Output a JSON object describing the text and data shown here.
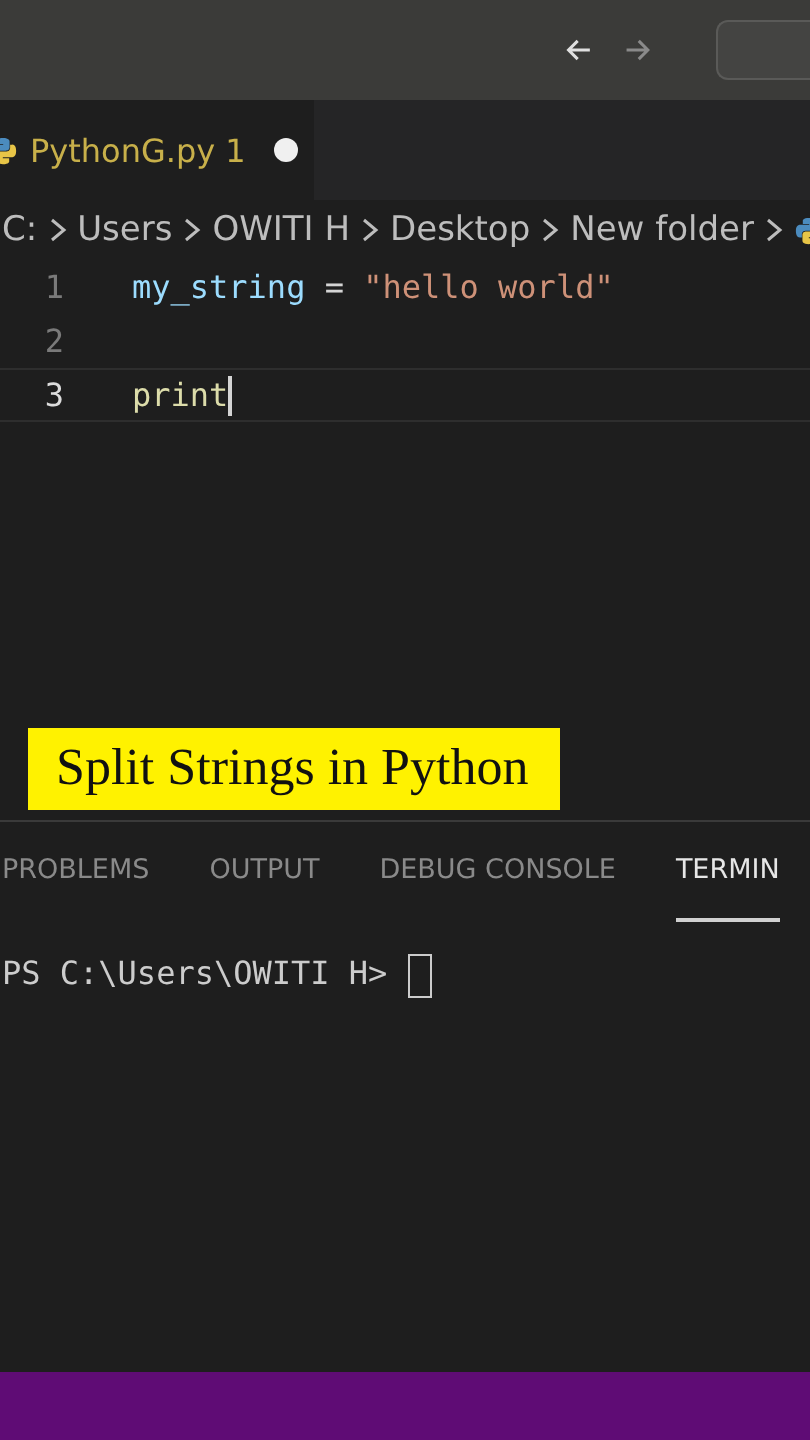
{
  "tabs": [
    {
      "label": "PythonG.py 1",
      "selected": true,
      "modified": true
    }
  ],
  "breadcrumb": [
    "C:",
    "Users",
    "OWITI H",
    "Desktop",
    "New folder"
  ],
  "code": [
    {
      "number": "1",
      "current": false,
      "tokens": [
        {
          "kind": "variable",
          "text": "my_string"
        },
        {
          "kind": "operator",
          "text": " = "
        },
        {
          "kind": "string",
          "text": "\"hello world\""
        }
      ]
    },
    {
      "number": "2",
      "current": false
    },
    {
      "number": "3",
      "current": true,
      "tokens": [
        {
          "kind": "function",
          "text": "print"
        }
      ]
    }
  ],
  "caption": "Split Strings in Python",
  "panel_tabs": [
    {
      "label": "PROBLEMS",
      "selected": false
    },
    {
      "label": "OUTPUT",
      "selected": false
    },
    {
      "label": "DEBUG CONSOLE",
      "selected": false
    },
    {
      "label": "TERMIN",
      "selected": true
    }
  ],
  "terminal": {
    "prompt": "PS C:\\Users\\OWITI H>"
  }
}
